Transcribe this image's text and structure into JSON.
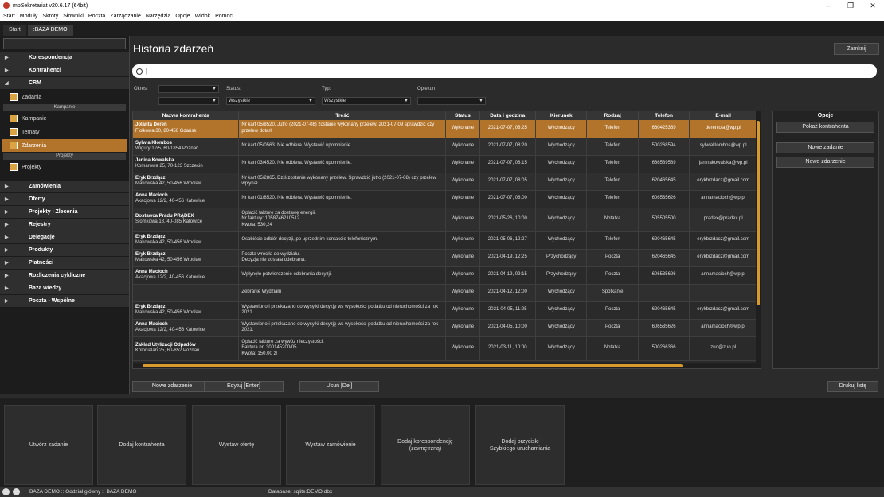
{
  "window": {
    "title": "mpSekretariat v20.6.17 (64bit)",
    "min": "–",
    "max": "❐",
    "close": "✕"
  },
  "menu": [
    "Start",
    "Moduły",
    "Skróty",
    "Słowniki",
    "Poczta",
    "Zarządzanie",
    "Narzędzia",
    "Opcje",
    "Widok",
    "Pomoc"
  ],
  "tabs": [
    "Start",
    ":BAZA DEMO"
  ],
  "sidebar": {
    "sections_top": [
      "Korespondencja",
      "Kontrahenci",
      "CRM"
    ],
    "crm_items": {
      "zadania": "Zadania",
      "group_kampanie": "Kampanie",
      "kampanie": "Kampanie",
      "tematy": "Tematy",
      "zdarzenia": "Zdarzenia",
      "group_projekty": "Projekty",
      "projekty": "Projekty"
    },
    "sections_bottom": [
      "Zamówienia",
      "Oferty",
      "Projekty i Zlecenia",
      "Rejestry",
      "Delegacje",
      "Produkty",
      "Płatności",
      "Rozliczenia cykliczne",
      "Baza wiedzy",
      "Poczta - Wspólne"
    ]
  },
  "page": {
    "title": "Historia zdarzeń",
    "close": "Zamknij",
    "search_value": "|"
  },
  "filters": {
    "okres_label": "Okres:",
    "status_label": "Status:",
    "status_value": "Wszystkie",
    "typ_label": "Typ:",
    "typ_value": "Wszystkie",
    "opiekun_label": "Opiekun:"
  },
  "table": {
    "headers": [
      "Nazwa kontrahenta",
      "Treść",
      "Status",
      "Data i godzina",
      "Kierunek",
      "Rodzaj",
      "Telefon",
      "E-mail"
    ],
    "rows": [
      {
        "name": "Jolanta Dereń",
        "addr": "Fiołkowa 30, 80-456 Gdańsk",
        "tresc": "Nr kart 05/8520. Jutro (2021-07-08) zostanie wykonany przelew. 2021-07-09 sprawdzić czy przelew dotarł.",
        "status": "Wykonane",
        "date": "2021-07-07, 08:25",
        "kier": "Wychodzący",
        "rodzaj": "Telefon",
        "tel": "660425369",
        "email": "derenjola@wp.pl"
      },
      {
        "name": "Sylwia Klombos",
        "addr": "Wigury 12/5, 60-1854 Poznań",
        "tresc": "Nr kart 05/0563. Nie odbiera. Wystawić upomnienie.",
        "status": "Wykonane",
        "date": "2021-07-07, 08:20",
        "kier": "Wychodzący",
        "rodzaj": "Telefon",
        "tel": "500268594",
        "email": "sylwiaklombos@wp.pl"
      },
      {
        "name": "Janina Kowalska",
        "addr": "Komarowa 25, 70-123 Szczecin",
        "tresc": "Nr kart 03/4520. Nie odbiera. Wystawić upomnienie.",
        "status": "Wykonane",
        "date": "2021-07-07, 08:15",
        "kier": "Wychodzący",
        "rodzaj": "Telefon",
        "tel": "666589589",
        "email": "janinakowalska@wp.pl"
      },
      {
        "name": "Eryk Brzdącz",
        "addr": "Makowska 42, 50-456 Wrocław",
        "tresc": "Nr kart 05/2865. Dziś zostanie wykonany przelew. Sprawdzić jutro (2021-07-08) czy przelew wpłynął.",
        "status": "Wykonane",
        "date": "2021-07-07, 08:05",
        "kier": "Wychodzący",
        "rodzaj": "Telefon",
        "tel": "620465645",
        "email": "erykbrzdacz@gmail.com"
      },
      {
        "name": "Anna Macioch",
        "addr": "Akacjowa 12/2, 40-456 Katowice",
        "tresc": "Nr kart 01/8520. Nie odbiera. Wystawić upomnienie.",
        "status": "Wykonane",
        "date": "2021-07-07, 08:00",
        "kier": "Wychodzący",
        "rodzaj": "Telefon",
        "tel": "606535626",
        "email": "annamacioch@wp.pl"
      },
      {
        "name": "Dostawca Prądu PRĄDEX",
        "addr": "Słomkowa 18, 40-085 Katowice",
        "tresc": "Opłacić fakturę za dostawę energii.\nNr faktury: 1058746210512\nKwota: 530,24",
        "status": "Wykonane",
        "date": "2021-05-26, 10:00",
        "kier": "Wychodzący",
        "rodzaj": "Notatka",
        "tel": "505505500",
        "email": "pradex@pradex.pl"
      },
      {
        "name": "Eryk Brzdącz",
        "addr": "Makowska 42, 50-456 Wrocław",
        "tresc": "Osobiście odbiór decyzji, po uprzednim kontakcie telefonicznym.",
        "status": "Wykonane",
        "date": "2021-05-06, 12:27",
        "kier": "Wychodzący",
        "rodzaj": "Telefon",
        "tel": "620465645",
        "email": "erykbrzdacz@gmail.com"
      },
      {
        "name": "Eryk Brzdącz",
        "addr": "Makowska 42, 50-456 Wrocław",
        "tresc": "Poczta wróciła do wydziału.\nDecyzja nie została odebrana.",
        "status": "Wykonane",
        "date": "2021-04-19, 12:25",
        "kier": "Przychodzący",
        "rodzaj": "Poczta",
        "tel": "620465645",
        "email": "erykbrzdacz@gmail.com"
      },
      {
        "name": "Anna Macioch",
        "addr": "Akacjowa 12/2, 40-456 Katowice",
        "tresc": "Wpłynęło potwierdzenie odebrania decyzji.",
        "status": "Wykonane",
        "date": "2021-04-19, 09:15",
        "kier": "Przychodzący",
        "rodzaj": "Poczta",
        "tel": "606535626",
        "email": "annamacioch@wp.pl"
      },
      {
        "name": "",
        "addr": "",
        "tresc": "Zebranie Wydziału",
        "status": "Wykonane",
        "date": "2021-04-12, 12:00",
        "kier": "Wychodzący",
        "rodzaj": "Spotkanie",
        "tel": "",
        "email": ""
      },
      {
        "name": "Eryk Brzdącz",
        "addr": "Makowska 42, 50-456 Wrocław",
        "tresc": "Wystawiono i przekazano do wysyłki decyzję ws wysokości podatku od nieruchomości za rok 2021.",
        "status": "Wykonane",
        "date": "2021-04-05, 11:25",
        "kier": "Wychodzący",
        "rodzaj": "Poczta",
        "tel": "620465645",
        "email": "erykbrzdacz@gmail.com"
      },
      {
        "name": "Anna Macioch",
        "addr": "Akacjowa 12/2, 40-456 Katowice",
        "tresc": "Wystawiono i przekazano do wysyłki decyzję ws wysokości podatku od nieruchomości za rok 2021.",
        "status": "Wykonane",
        "date": "2021-04-05, 10:00",
        "kier": "Wychodzący",
        "rodzaj": "Poczta",
        "tel": "606535626",
        "email": "annamacioch@wp.pl"
      },
      {
        "name": "Zakład Utylizacji Odpadów",
        "addr": "Kolonialan 25, 60-852 Poznań",
        "tresc": "Opłacić fakturę za wywóz nieczystości.\nFaktura nr: 300145200/05\nKwota: 150,00 zł",
        "status": "Wykonane",
        "date": "2021-03-11, 10:00",
        "kier": "Wychodzący",
        "rodzaj": "Notatka",
        "tel": "500266366",
        "email": "zuo@zuo.pl"
      }
    ]
  },
  "options": {
    "header": "Opcje",
    "show_contractor": "Pokaż kontrahenta",
    "new_task": "Nowe zadanie",
    "new_event": "Nowe zdarzenie"
  },
  "actions": {
    "new_event": "Nowe zdarzenie",
    "edit": "Edytuj [Enter]",
    "delete": "Usuń [Del]",
    "print": "Drukuj listę"
  },
  "quick": [
    "Utwórz zadanie",
    "Dodaj kontrahenta",
    "Wystaw ofertę",
    "Wystaw zamówienie",
    "Dodaj korespondencję\n(zewnętrzną)",
    "Dodaj przyciski\nSzybkiego uruchamiania"
  ],
  "status": {
    "left": "BAZA DEMO :: Oddział główny :: BAZA DEMO",
    "db": "Database: sqlite:DEMO.dbx"
  }
}
